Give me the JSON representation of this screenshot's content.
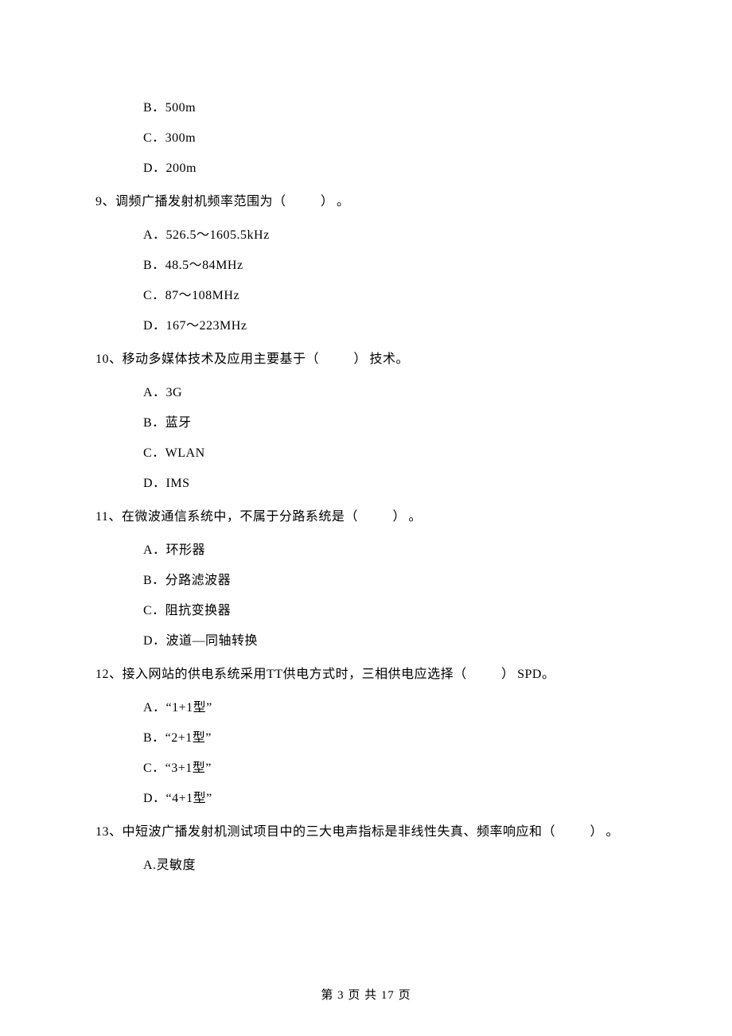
{
  "blank_text": "（　　）",
  "top_options": [
    "B．500m",
    "C．300m",
    "D．200m"
  ],
  "questions": [
    {
      "num": "9、",
      "stem_pre": "调频广播发射机频率范围为",
      "stem_post": "。",
      "options": [
        "A．526.5～1605.5kHz",
        "B．48.5～84MHz",
        "C．87～108MHz",
        "D．167～223MHz"
      ]
    },
    {
      "num": "10、",
      "stem_pre": "移动多媒体技术及应用主要基于",
      "stem_post": "技术。",
      "options": [
        "A．3G",
        "B．蓝牙",
        "C．WLAN",
        "D．IMS"
      ]
    },
    {
      "num": "11、",
      "stem_pre": "在微波通信系统中，不属于分路系统是",
      "stem_post": "。",
      "options": [
        "A．环形器",
        "B．分路滤波器",
        "C．阻抗变换器",
        "D．波道—同轴转换"
      ]
    },
    {
      "num": "12、",
      "stem_pre": "接入网站的供电系统采用TT供电方式时，三相供电应选择",
      "stem_post": "SPD。",
      "options": [
        "A．“1+1型”",
        "B．“2+1型”",
        "C．“3+1型”",
        "D．“4+1型”"
      ]
    },
    {
      "num": "13、",
      "stem_pre": "中短波广播发射机测试项目中的三大电声指标是非线性失真、频率响应和",
      "stem_post": "。",
      "options": [
        "A.灵敏度"
      ]
    }
  ],
  "footer": "第 3 页 共 17 页"
}
